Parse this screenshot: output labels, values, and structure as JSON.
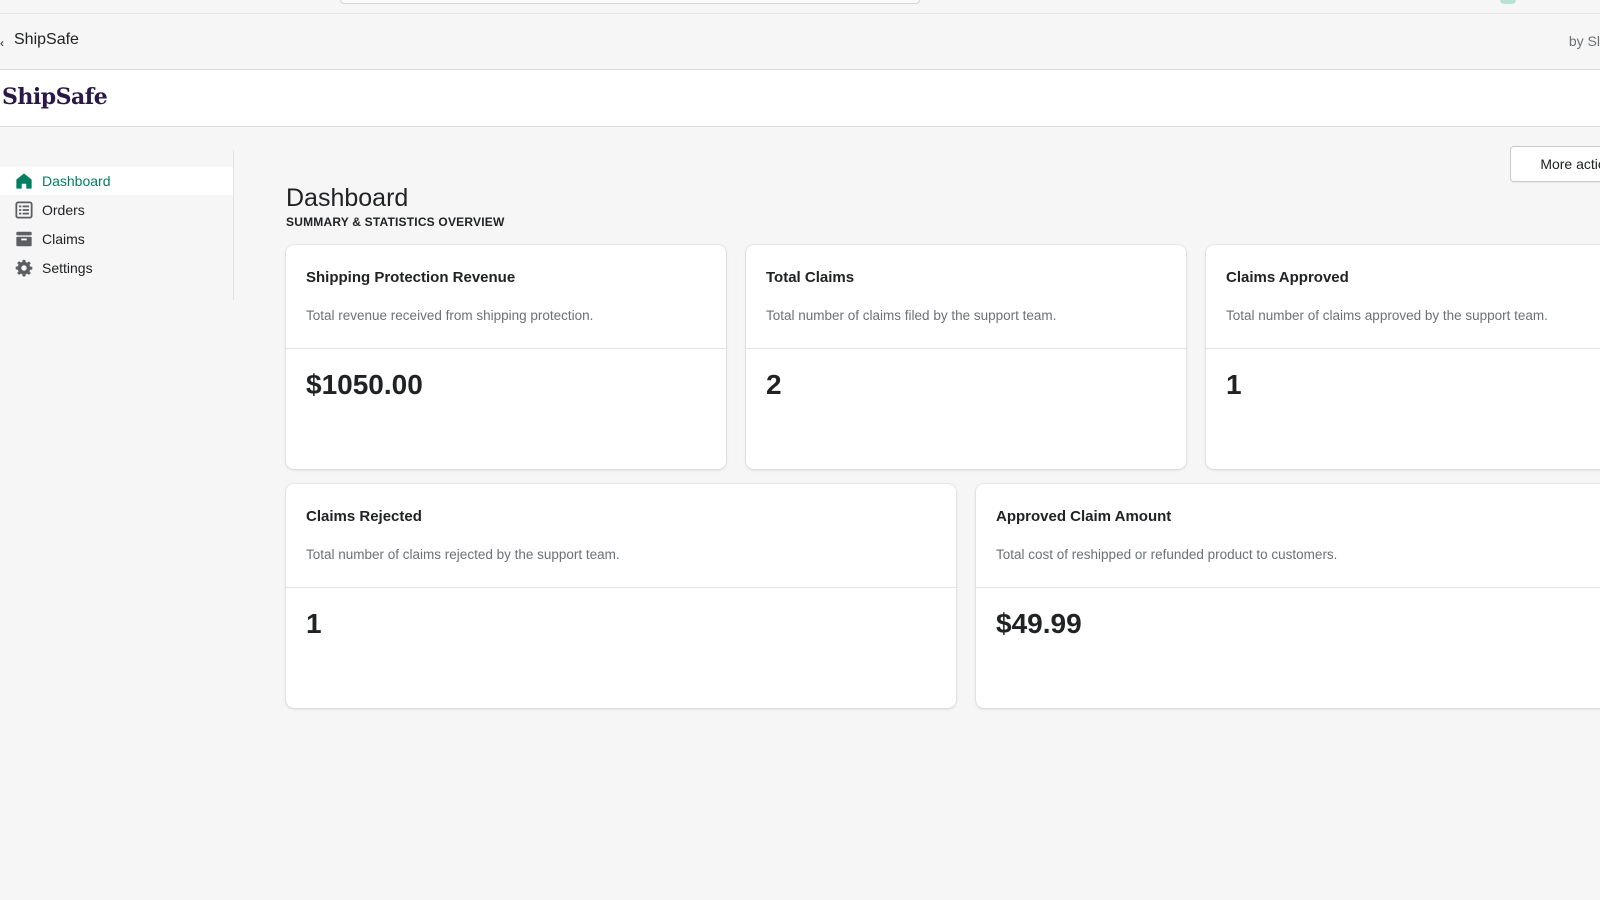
{
  "app_bar": {
    "app_name": "ShipSafe",
    "by_text": "by Sl"
  },
  "brand": {
    "logo_text": "ShipSafe"
  },
  "sidebar": {
    "items": [
      {
        "label": "Dashboard",
        "icon": "home-icon",
        "active": true
      },
      {
        "label": "Orders",
        "icon": "list-icon",
        "active": false
      },
      {
        "label": "Claims",
        "icon": "archive-icon",
        "active": false
      },
      {
        "label": "Settings",
        "icon": "gear-icon",
        "active": false
      }
    ]
  },
  "header": {
    "more_actions_label": "More actio",
    "title": "Dashboard",
    "subtitle": "SUMMARY & STATISTICS OVERVIEW"
  },
  "cards": [
    {
      "title": "Shipping Protection Revenue",
      "description": "Total revenue received from shipping protection.",
      "value": "$1050.00"
    },
    {
      "title": "Total Claims",
      "description": "Total number of claims filed by the support team.",
      "value": "2"
    },
    {
      "title": "Claims Approved",
      "description": "Total number of claims approved by the support team.",
      "value": "1"
    },
    {
      "title": "Claims Rejected",
      "description": "Total number of claims rejected by the support team.",
      "value": "1"
    },
    {
      "title": "Approved Claim Amount",
      "description": "Total cost of reshipped or refunded product to customers.",
      "value": "$49.99"
    }
  ],
  "colors": {
    "accent": "#008060",
    "brand": "#2a1847",
    "background": "#f6f6f7"
  }
}
